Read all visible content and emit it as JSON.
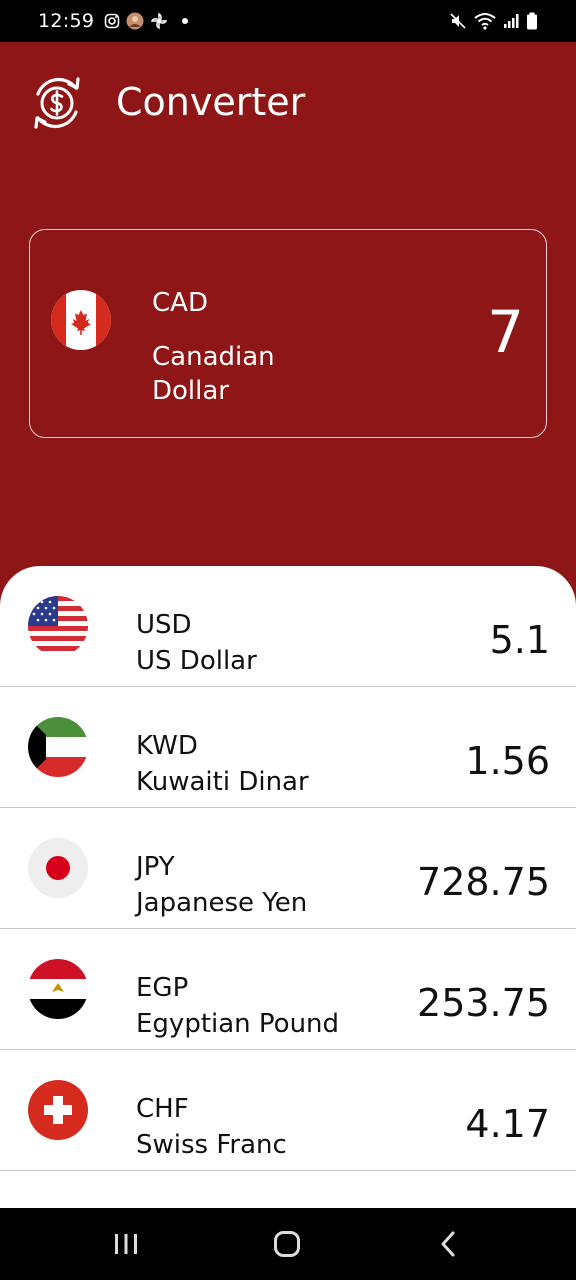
{
  "status_bar": {
    "time": "12:59"
  },
  "header": {
    "title": "Converter",
    "logo_icon": "currency-exchange-icon"
  },
  "base": {
    "code": "CAD",
    "name": "Canadian Dollar",
    "amount": "7",
    "flag": "canada-flag"
  },
  "rates": [
    {
      "code": "USD",
      "name": "US Dollar",
      "value": "5.1",
      "flag": "usa-flag"
    },
    {
      "code": "KWD",
      "name": "Kuwaiti Dinar",
      "value": "1.56",
      "flag": "kuwait-flag"
    },
    {
      "code": "JPY",
      "name": "Japanese Yen",
      "value": "728.75",
      "flag": "japan-flag"
    },
    {
      "code": "EGP",
      "name": "Egyptian Pound",
      "value": "253.75",
      "flag": "egypt-flag"
    },
    {
      "code": "CHF",
      "name": "Swiss Franc",
      "value": "4.17",
      "flag": "switzerland-flag"
    }
  ],
  "colors": {
    "accent": "#8f1617",
    "card_border": "#f3d3d3"
  }
}
